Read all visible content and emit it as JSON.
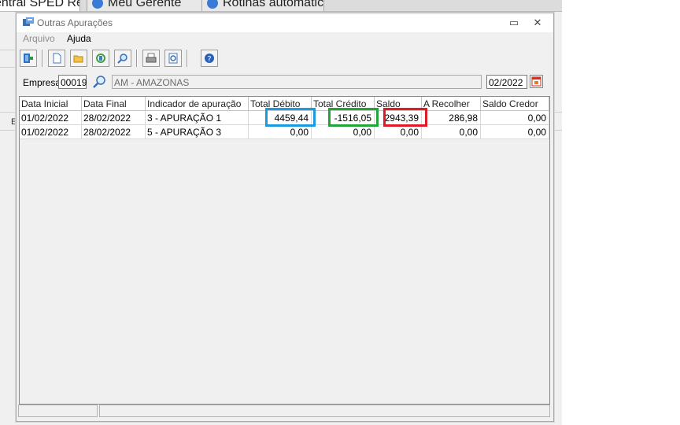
{
  "background": {
    "tabs": [
      {
        "label": "entral SPED Reinf"
      },
      {
        "label": "Meu Gerente"
      },
      {
        "label": "Rotinas automáticas"
      }
    ],
    "side_letter": "E"
  },
  "dialog": {
    "title": "Outras Apurações",
    "minimize_glyph": "▭",
    "close_glyph": "✕",
    "menu": [
      {
        "label": "Arquivo",
        "enabled": false
      },
      {
        "label": "Ajuda",
        "enabled": true
      }
    ],
    "toolbar_icons": [
      "exit-icon",
      "new-document-icon",
      "open-folder-icon",
      "refresh-icon",
      "search-icon",
      "print-icon",
      "print-preview-icon",
      "help-icon"
    ]
  },
  "filter": {
    "empresa_label": "Empresa",
    "empresa_code": "00019",
    "empresa_name": "AM - AMAZONAS",
    "period": "02/2022"
  },
  "grid": {
    "columns": [
      "Data Inicial",
      "Data Final",
      "Indicador de apuração",
      "Total Débito",
      "Total Crédito",
      "Saldo",
      "A Recolher",
      "Saldo Credor"
    ],
    "rows": [
      [
        "01/02/2022",
        "28/02/2022",
        "3 - APURAÇÃO 1",
        "4459,44",
        "-1516,05",
        "2943,39",
        "286,98",
        "0,00"
      ],
      [
        "01/02/2022",
        "28/02/2022",
        "5 - APURAÇÃO 3",
        "0,00",
        "0,00",
        "0,00",
        "0,00",
        "0,00"
      ]
    ],
    "highlights": [
      {
        "target": "total-debito",
        "color": "#1a9be0"
      },
      {
        "target": "total-credito",
        "color": "#22a538"
      },
      {
        "target": "saldo",
        "color": "#e01b24"
      }
    ]
  }
}
